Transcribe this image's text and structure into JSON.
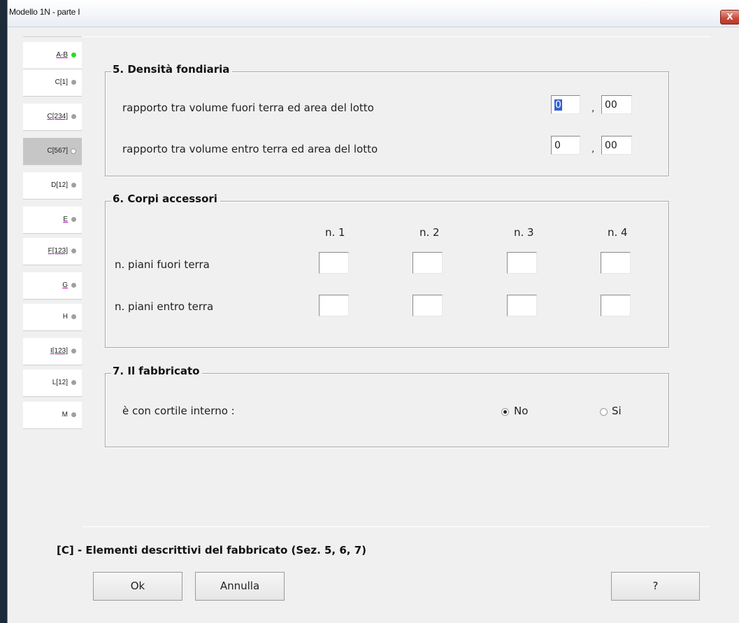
{
  "window": {
    "title": "Modello 1N  -   parte I",
    "close_label": "X"
  },
  "tabs": [
    {
      "label": "A-B",
      "status": "green"
    },
    {
      "label": "C[1]",
      "status": "gray"
    },
    {
      "label": "C[234]",
      "status": "gray"
    },
    {
      "label": "C[567]",
      "status": "white",
      "selected": true
    },
    {
      "label": "D[12]",
      "status": "gray"
    },
    {
      "label": "E",
      "status": "gray"
    },
    {
      "label": "F[123]",
      "status": "gray"
    },
    {
      "label": "G",
      "status": "gray"
    },
    {
      "label": "H",
      "status": "gray"
    },
    {
      "label": "I[123]",
      "status": "gray"
    },
    {
      "label": "L[12]",
      "status": "gray"
    },
    {
      "label": "M",
      "status": "gray"
    }
  ],
  "sec5": {
    "title": "5. Densità fondiaria",
    "row1": {
      "label": "rapporto tra volume fuori terra ed area del lotto",
      "int_value": "0",
      "sep": ",",
      "dec_value": "00"
    },
    "row2": {
      "label": "rapporto tra volume entro terra ed area del lotto",
      "int_value": "0",
      "sep": ",",
      "dec_value": "00"
    }
  },
  "sec6": {
    "title": "6. Corpi accessori",
    "columns": [
      "n. 1",
      "n. 2",
      "n. 3",
      "n. 4"
    ],
    "row1_label": "n. piani fuori terra",
    "row2_label": "n. piani entro terra",
    "row1_values": [
      "",
      "",
      "",
      ""
    ],
    "row2_values": [
      "",
      "",
      "",
      ""
    ]
  },
  "sec7": {
    "title": "7. Il fabbricato",
    "question": "è con cortile interno :",
    "options": [
      {
        "label": "No",
        "checked": true
      },
      {
        "label": "Si",
        "checked": false
      }
    ]
  },
  "footer": {
    "description": "[C] - Elementi descrittivi del fabbricato (Sez. 5, 6, 7)"
  },
  "buttons": {
    "ok": "Ok",
    "cancel": "Annulla",
    "help": "?"
  }
}
